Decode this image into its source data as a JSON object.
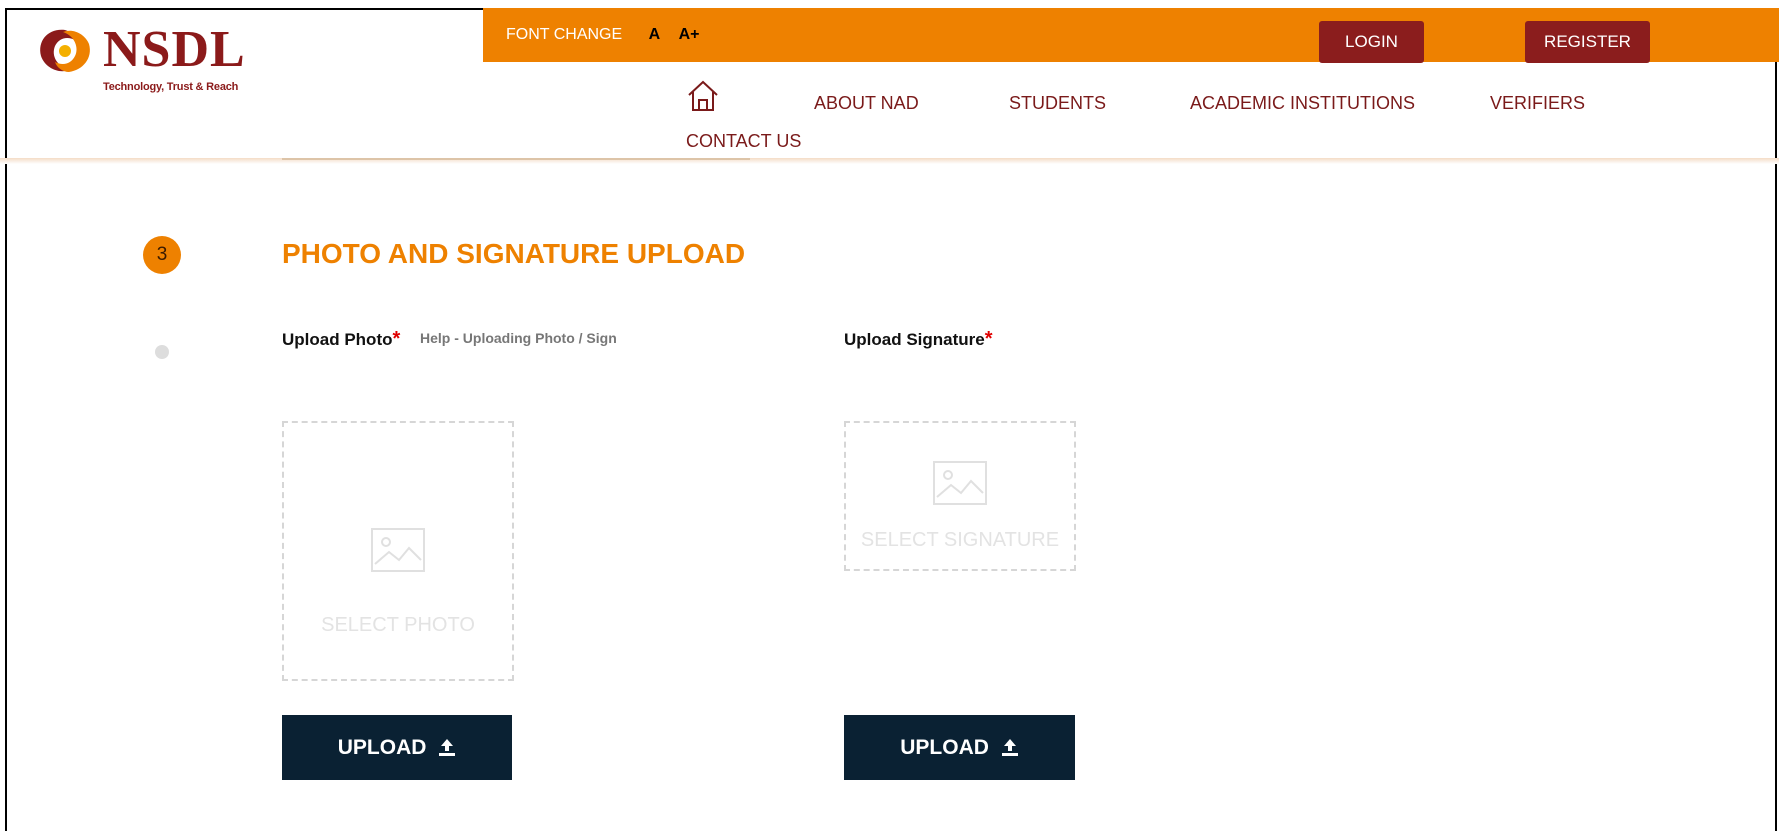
{
  "brand": {
    "name": "NSDL",
    "tagline": "Technology, Trust & Reach",
    "colors": {
      "brand_maroon": "#8b1a1a",
      "accent_orange": "#ee8100",
      "dark_navy": "#0a2133"
    }
  },
  "topbar": {
    "font_change_label": "FONT CHANGE",
    "font_normal": "A",
    "font_large": "A+",
    "login": "LOGIN",
    "register": "REGISTER"
  },
  "nav": {
    "home_icon": "home-icon",
    "items": [
      "ABOUT NAD",
      "STUDENTS",
      "ACADEMIC INSTITUTIONS",
      "VERIFIERS",
      "CONTACT US"
    ]
  },
  "step": {
    "number": "3",
    "title": "PHOTO AND SIGNATURE UPLOAD"
  },
  "photo": {
    "label": "Upload Photo",
    "required_mark": "*",
    "help_link": "Help - Uploading Photo / Sign",
    "dropzone_text": "SELECT PHOTO",
    "upload_button": "UPLOAD"
  },
  "signature": {
    "label": "Upload Signature",
    "required_mark": "*",
    "dropzone_text": "SELECT SIGNATURE",
    "upload_button": "UPLOAD"
  }
}
